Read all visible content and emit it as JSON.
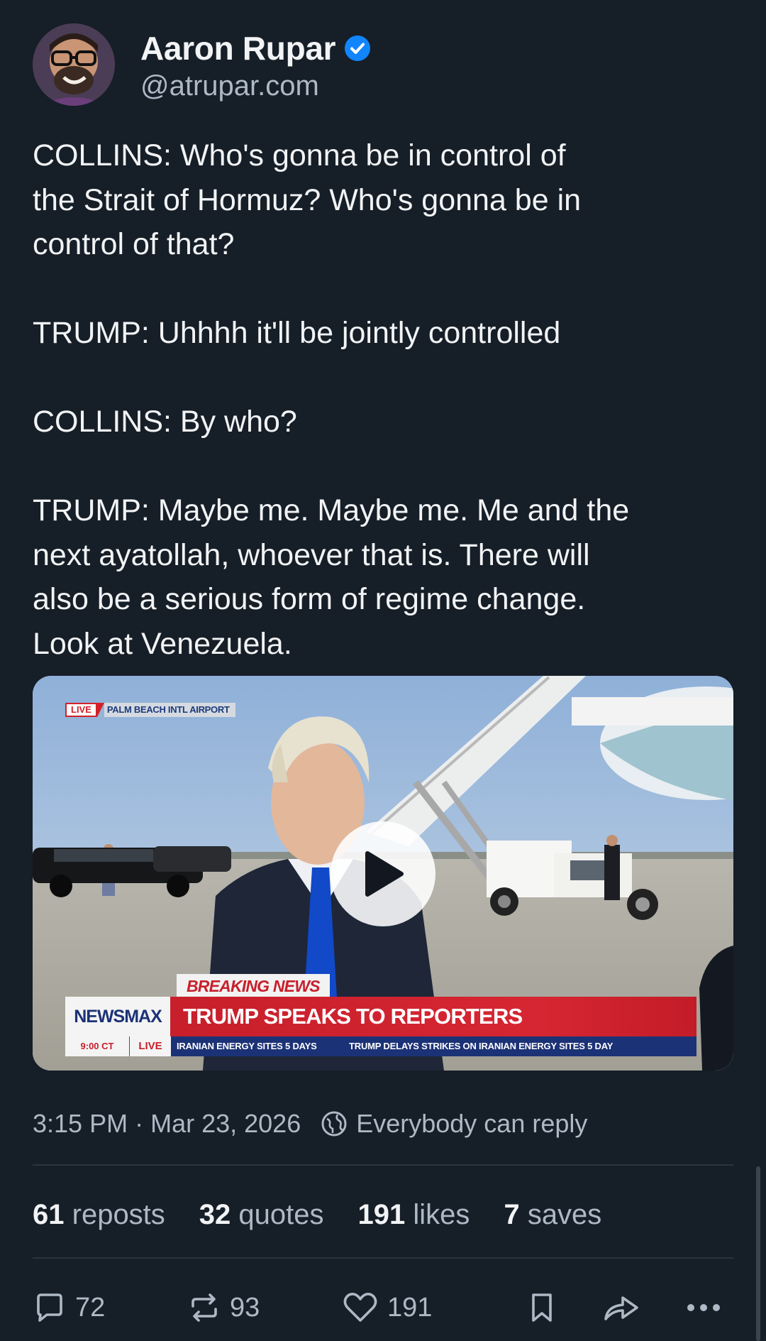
{
  "author": {
    "display_name": "Aaron Rupar",
    "handle": "@atrupar.com",
    "verified": true
  },
  "post": {
    "text": "COLLINS: Who's gonna be in control of\nthe Strait of Hormuz? Who's gonna be in\ncontrol of that?\n\nTRUMP: Uhhhh it'll be jointly controlled\n\nCOLLINS: By who?\n\nTRUMP: Maybe me. Maybe me. Me and the\nnext ayatollah, whoever that is. There will\nalso be a serious form of regime change.\nLook at Venezuela."
  },
  "video": {
    "location_live": "LIVE",
    "location_name": "PALM BEACH INTL AIRPORT",
    "breaking_label": "BREAKING NEWS",
    "network": "NEWSMAX",
    "headline": "TRUMP SPEAKS TO REPORTERS",
    "ticker_time": "9:00 CT",
    "ticker_live": "LIVE",
    "ticker_items": [
      "IRANIAN ENERGY SITES 5 DAYS",
      "TRUMP DELAYS STRIKES ON IRANIAN ENERGY SITES 5 DAY"
    ],
    "play_icon": "play-icon"
  },
  "meta": {
    "time": "3:15 PM",
    "separator": "·",
    "date": "Mar 23, 2026",
    "reply_setting": "Everybody can reply"
  },
  "stats": {
    "reposts": {
      "count": "61",
      "label": "reposts"
    },
    "quotes": {
      "count": "32",
      "label": "quotes"
    },
    "likes": {
      "count": "191",
      "label": "likes"
    },
    "saves": {
      "count": "7",
      "label": "saves"
    }
  },
  "actions": {
    "reply_count": "72",
    "repost_count": "93",
    "like_count": "191",
    "icons": [
      "reply-icon",
      "repost-icon",
      "like-icon",
      "bookmark-icon",
      "share-icon",
      "more-icon"
    ]
  },
  "colors": {
    "background": "#161e27",
    "text": "#f1f3f5",
    "muted": "#aeb9c6",
    "verified": "#1185fe",
    "newsmax_red": "#d62633",
    "newsmax_blue": "#1c3276"
  }
}
